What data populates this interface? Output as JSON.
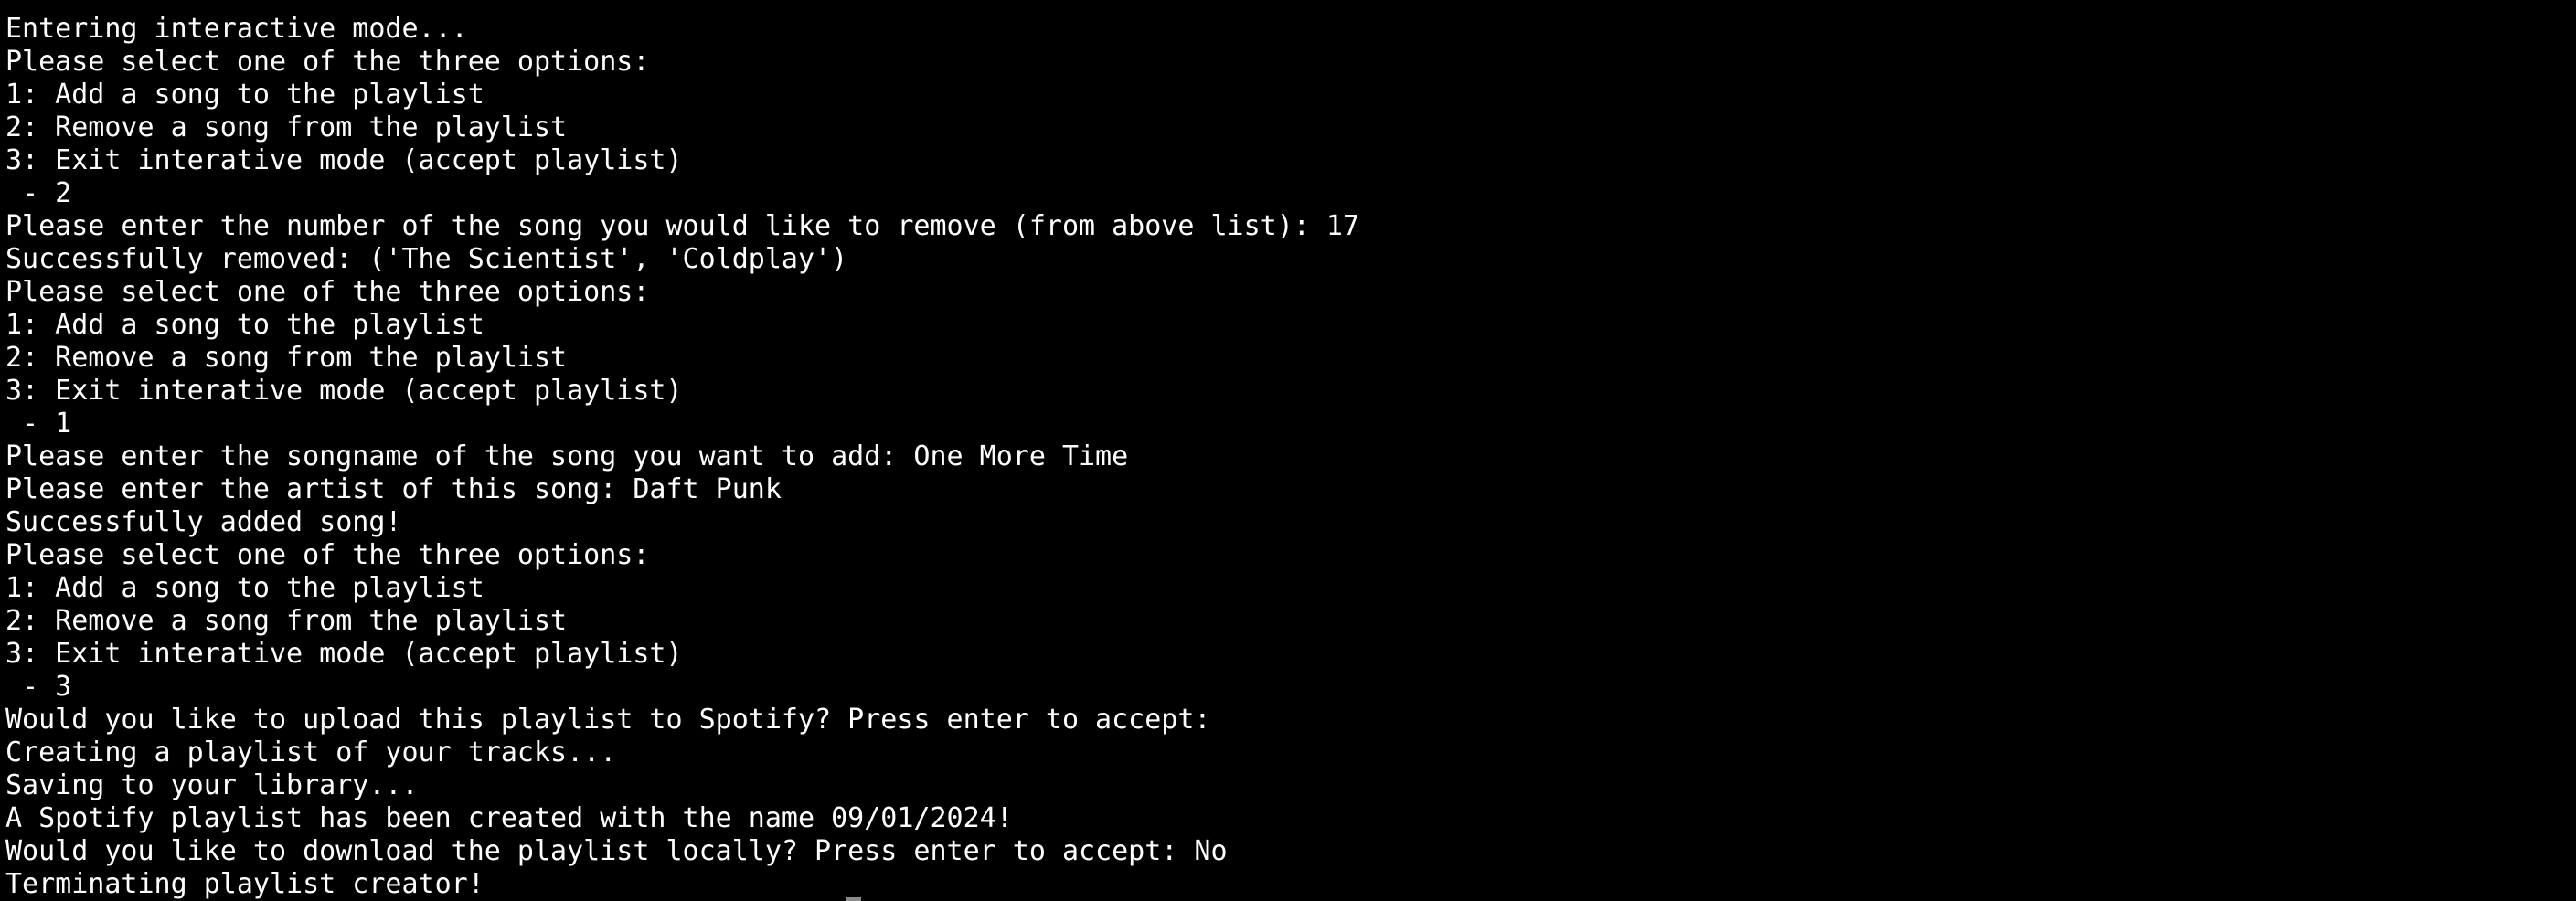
{
  "terminal": {
    "lines": [
      "Entering interactive mode...",
      "Please select one of the three options:",
      "1: Add a song to the playlist",
      "2: Remove a song from the playlist",
      "3: Exit interative mode (accept playlist)",
      " - 2",
      "Please enter the number of the song you would like to remove (from above list): 17",
      "Successfully removed: ('The Scientist', 'Coldplay')",
      "Please select one of the three options:",
      "1: Add a song to the playlist",
      "2: Remove a song from the playlist",
      "3: Exit interative mode (accept playlist)",
      " - 1",
      "Please enter the songname of the song you want to add: One More Time",
      "Please enter the artist of this song: Daft Punk",
      "Successfully added song!",
      "Please select one of the three options:",
      "1: Add a song to the playlist",
      "2: Remove a song from the playlist",
      "3: Exit interative mode (accept playlist)",
      " - 3",
      "Would you like to upload this playlist to Spotify? Press enter to accept:",
      "Creating a playlist of your tracks...",
      "Saving to your library...",
      "A Spotify playlist has been created with the name 09/01/2024!",
      "Would you like to download the playlist locally? Press enter to accept: No",
      "Terminating playlist creator!"
    ]
  },
  "colors": {
    "background": "#000000",
    "foreground": "#ffffff"
  }
}
